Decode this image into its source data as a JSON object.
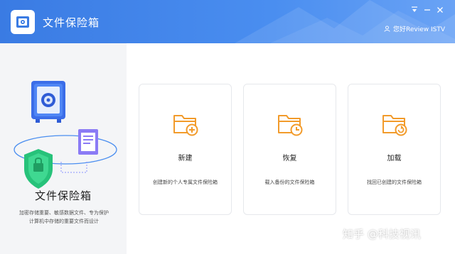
{
  "app": {
    "title": "文件保险箱",
    "user_label": "您好Review ISTV"
  },
  "window_controls": [
    {
      "icon": "dropdown-icon"
    },
    {
      "icon": "minimize-icon"
    },
    {
      "icon": "close-icon"
    }
  ],
  "left_panel": {
    "title": "文件保险箱",
    "description": "加密存储重要、敏感数据文件、专为保护计算机中存储的重要文件而设计"
  },
  "cards": [
    {
      "label": "新建",
      "description": "创建新的个人专属文件保险箱",
      "icon": "folder-add-icon"
    },
    {
      "label": "恢复",
      "description": "载入备份的文件保险箱",
      "icon": "folder-clock-icon"
    },
    {
      "label": "加载",
      "description": "找回已创建的文件保险箱",
      "icon": "folder-reload-icon"
    }
  ],
  "watermark": "知乎 @科技视讯",
  "colors": {
    "header": "#3a7be3",
    "accent_orange": "#f29b2b",
    "left_bg": "#f4f5f7"
  }
}
